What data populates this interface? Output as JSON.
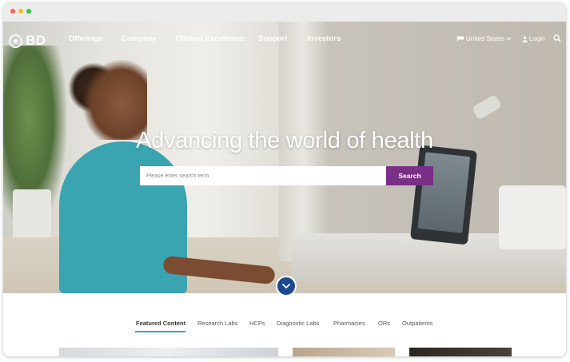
{
  "brand": {
    "logo_text": "BD",
    "accent_purple": "#7a2f86",
    "accent_teal": "#3aa9b4",
    "scroll_blue": "#1b4a93"
  },
  "nav": {
    "items": [
      "Offerings",
      "Company",
      "Clinical Excellence",
      "Support",
      "Investors"
    ],
    "region_label": "United States",
    "login_label": "Login",
    "icons": {
      "flag": "flag-icon",
      "chevron": "chevron-down-icon",
      "user": "user-icon",
      "search": "search-icon"
    }
  },
  "hero": {
    "headline": "Advancing the world of health",
    "search_placeholder": "Please enter search term",
    "search_value": "",
    "search_button": "Search",
    "scroll_icon": "chevron-down-icon"
  },
  "tabs": [
    {
      "label": "Featured Content",
      "active": true
    },
    {
      "label": "Research Labs",
      "active": false
    },
    {
      "label": "HCPs",
      "active": false
    },
    {
      "label": "Diagnostic Labs",
      "active": false
    },
    {
      "label": "Pharmacies",
      "active": false
    },
    {
      "label": "ORs",
      "active": false
    },
    {
      "label": "Outpatients",
      "active": false
    }
  ]
}
